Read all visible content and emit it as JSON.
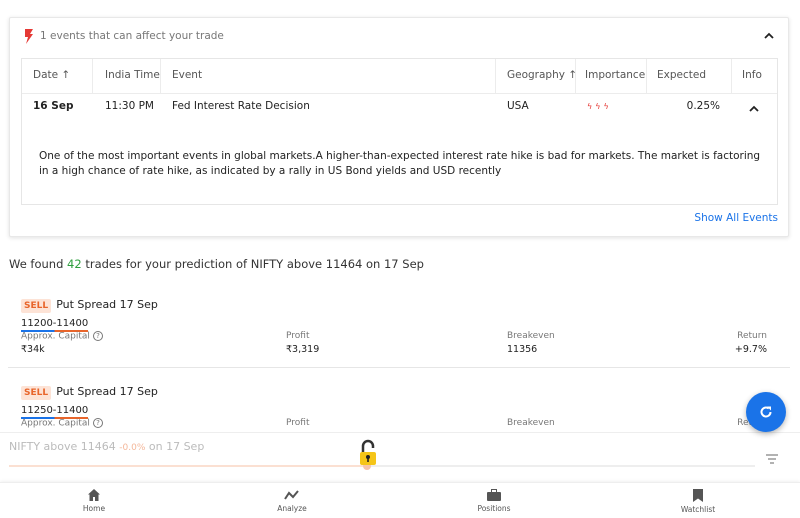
{
  "events_card": {
    "header": "1 events that can affect your trade",
    "icon": "flash-icon",
    "columns": [
      "Date ↑",
      "India Time",
      "Event",
      "Geography ↑",
      "Importance",
      "Expected",
      "Info"
    ],
    "row": {
      "date": "16 Sep",
      "time": "11:30 PM",
      "event": "Fed Interest Rate Decision",
      "geography": "USA",
      "importance": 3,
      "expected": "0.25%"
    },
    "description": "One of the most important events in global markets.A higher-than-expected interest rate hike is bad for markets. The market is factoring in a high chance of rate hike, as indicated by a rally in US Bond yields and USD recently",
    "show_all": "Show All Events"
  },
  "summary": {
    "prefix": "We found ",
    "count": "42",
    "middle": " trades for your prediction of ",
    "prediction": "NIFTY above 11464 on 17 Sep"
  },
  "trades": [
    {
      "action": "SELL",
      "title": "Put Spread 17 Sep",
      "range": "11200-11400",
      "capital_label": "Approx. Capital",
      "capital": "₹34k",
      "profit_label": "Profit",
      "profit": "₹3,319",
      "breakeven_label": "Breakeven",
      "breakeven": "11356",
      "return_label": "Return",
      "return": "+9.7%"
    },
    {
      "action": "SELL",
      "title": "Put Spread 17 Sep",
      "range": "11250-11400",
      "capital_label": "Approx. Capital",
      "profit_label": "Profit",
      "breakeven_label": "Breakeven",
      "return_label": "Return"
    }
  ],
  "prediction_bar": {
    "prefix": "NIFTY above 11464 ",
    "change": "-0.0%",
    "suffix": " on 17 Sep",
    "slider_fraction": 0.48
  },
  "nav": [
    {
      "label": "Home",
      "icon": "home-icon"
    },
    {
      "label": "Analyze",
      "icon": "analyze-icon"
    },
    {
      "label": "Positions",
      "icon": "briefcase-icon"
    },
    {
      "label": "Watchlist",
      "icon": "bookmark-icon"
    }
  ],
  "colors": {
    "accent": "#1a73e8",
    "sell": "#e8652b",
    "positive": "#2e9e3e",
    "importance": "#e53935"
  }
}
